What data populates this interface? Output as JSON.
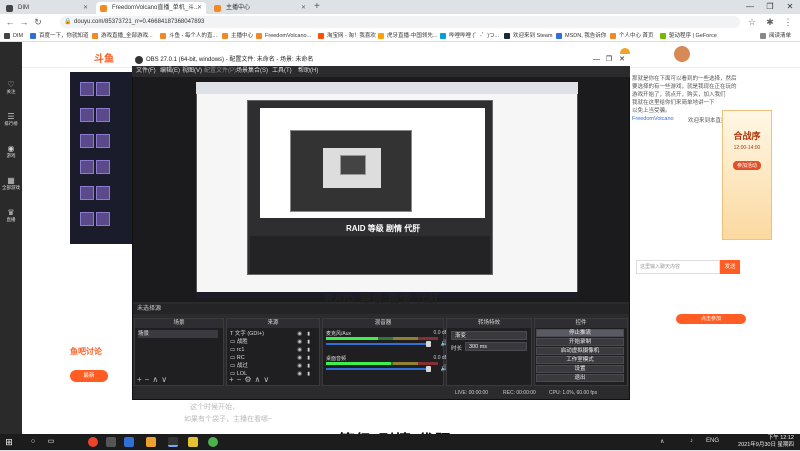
{
  "browser": {
    "tabs": [
      {
        "label": "DIM",
        "active": false
      },
      {
        "label": "FreedomVolcano直播_单机_斗...",
        "active": true
      },
      {
        "label": "主播中心",
        "active": false
      }
    ],
    "new_tab": "+",
    "url": "douyu.com/85373721_rr=0.46684187368047893",
    "bookmarks": [
      "DIM",
      "百度一下，你就知道",
      "游戏直播_全部游戏...",
      "斗鱼 - 每个人的直...",
      "主播中心",
      "FreedomVolcano...",
      "淘宝网 - 淘！我喜欢",
      "虎牙直播-中国领先...",
      "哔哩哔哩 (゜-゜)つ...",
      "欢迎来到 Steam",
      "MSDN, 我告诉你",
      "个人中心 首页",
      "驱动程序 | GeForce",
      "阅读清单"
    ]
  },
  "douyu": {
    "left_nav": [
      "关注",
      "排行榜",
      "游戏",
      "全部游戏",
      "直播"
    ],
    "streamer_link": "FreedomVolcano",
    "chat_lines": [
      "那就是你在下面可以看到的一些选择，然后",
      "要选择的有一些游戏，就是我现在正在玩的",
      "游戏开始了，就点开，购买，加入我们",
      "我就在这里给你们来简单地讲一下",
      "以免上当受骗。"
    ],
    "welcome": "欢迎来到本直播间",
    "ad": {
      "title": "合战序",
      "subtitle": "12:00-14:00",
      "button": "参加活动"
    },
    "chat_placeholder": "这里输入聊天内容",
    "send": "发送",
    "fish_title": "鱼吧讨论",
    "fish_tab": "最新",
    "ad_badge": "点击参加",
    "subtitle1": "这个时候开始，",
    "subtitle2": "如果有个袋子，主播在看哪~",
    "big_caption": "RAID 等级 剧情 代肝"
  },
  "obs": {
    "title": "OBS 27.0.1 (64-bit, windows) - 配置文件: 未命名 - 场景: 未命名",
    "menu": [
      "文件(F)",
      "编辑(E)",
      "视图(V)",
      "配置文件(P)",
      "场景集合(S)",
      "工具(T)",
      "帮助(H)"
    ],
    "nested_caption_small": "RAID 等级 剧情 代肝",
    "nested_caption": "RAID 等级 剧情 代肝",
    "scene_bar": "未选择源",
    "docks": {
      "scenes": {
        "title": "场景",
        "items": [
          "场景"
        ]
      },
      "sources": {
        "title": "来源",
        "items": [
          "文字 (GDI+)",
          "战胜",
          "rc1",
          "RC",
          "战过",
          "LOL"
        ]
      },
      "mixer": {
        "title": "混音器",
        "channels": [
          {
            "name": "麦克风/Aux",
            "db": "0.0 dB",
            "level": 0.46
          },
          {
            "name": "桌面音频",
            "db": "0.0 dB",
            "level": 0.58
          }
        ]
      },
      "transitions": {
        "title": "转场特效",
        "type": "渐变",
        "duration_label": "时长",
        "duration": "300 ms"
      },
      "controls": {
        "title": "控件",
        "buttons": [
          "停止推流",
          "开始录制",
          "启动虚拟摄像机",
          "工作室模式",
          "设置",
          "退出"
        ]
      }
    },
    "status": {
      "live": "LIVE: 00:00:00",
      "rec": "REC: 00:00:00",
      "cpu": "CPU: 1.0%, 60.00 fps"
    }
  },
  "taskbar": {
    "time": "下午 12:12",
    "date": "2021年9月30日 星期四",
    "lang": "ENG"
  }
}
